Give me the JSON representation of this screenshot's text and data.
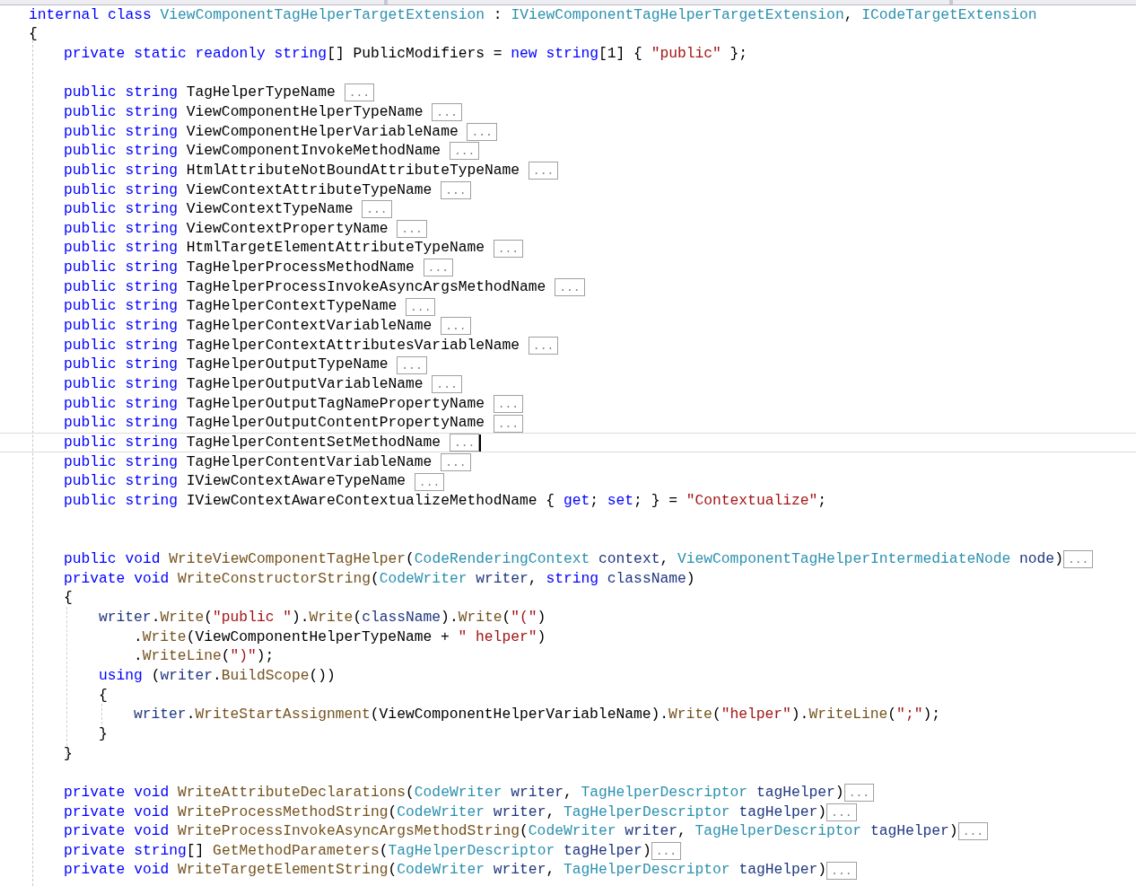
{
  "lines": [
    {
      "kind": "code",
      "current": false,
      "tokens": [
        {
          "kind": "keyword",
          "text": "internal class "
        },
        {
          "kind": "type",
          "text": "ViewComponentTagHelperTargetExtension"
        },
        {
          "kind": "plain",
          "text": " : "
        },
        {
          "kind": "type",
          "text": "IViewComponentTagHelperTargetExtension"
        },
        {
          "kind": "plain",
          "text": ", "
        },
        {
          "kind": "type",
          "text": "ICodeTargetExtension"
        }
      ]
    },
    {
      "kind": "code",
      "current": false,
      "tokens": [
        {
          "kind": "plain",
          "text": "{"
        }
      ],
      "children": [
        {
          "kind": "code",
          "current": false,
          "tokens": [
            {
              "kind": "keyword",
              "text": "private static readonly string"
            },
            {
              "kind": "plain",
              "text": "[] PublicModifiers = "
            },
            {
              "kind": "keyword",
              "text": "new string"
            },
            {
              "kind": "plain",
              "text": "[1] { "
            },
            {
              "kind": "string",
              "text": "\"public\""
            },
            {
              "kind": "plain",
              "text": " };"
            }
          ]
        },
        {
          "kind": "blank",
          "current": false
        },
        {
          "kind": "code",
          "current": false,
          "tokens": [
            {
              "kind": "keyword",
              "text": "public string"
            },
            {
              "kind": "plain",
              "text": " TagHelperTypeName "
            }
          ],
          "fold": "..."
        },
        {
          "kind": "code",
          "current": false,
          "tokens": [
            {
              "kind": "keyword",
              "text": "public string"
            },
            {
              "kind": "plain",
              "text": " ViewComponentHelperTypeName "
            }
          ],
          "fold": "..."
        },
        {
          "kind": "code",
          "current": false,
          "tokens": [
            {
              "kind": "keyword",
              "text": "public string"
            },
            {
              "kind": "plain",
              "text": " ViewComponentHelperVariableName "
            }
          ],
          "fold": "..."
        },
        {
          "kind": "code",
          "current": false,
          "tokens": [
            {
              "kind": "keyword",
              "text": "public string"
            },
            {
              "kind": "plain",
              "text": " ViewComponentInvokeMethodName "
            }
          ],
          "fold": "..."
        },
        {
          "kind": "code",
          "current": false,
          "tokens": [
            {
              "kind": "keyword",
              "text": "public string"
            },
            {
              "kind": "plain",
              "text": " HtmlAttributeNotBoundAttributeTypeName "
            }
          ],
          "fold": "..."
        },
        {
          "kind": "code",
          "current": false,
          "tokens": [
            {
              "kind": "keyword",
              "text": "public string"
            },
            {
              "kind": "plain",
              "text": " ViewContextAttributeTypeName "
            }
          ],
          "fold": "..."
        },
        {
          "kind": "code",
          "current": false,
          "tokens": [
            {
              "kind": "keyword",
              "text": "public string"
            },
            {
              "kind": "plain",
              "text": " ViewContextTypeName "
            }
          ],
          "fold": "..."
        },
        {
          "kind": "code",
          "current": false,
          "tokens": [
            {
              "kind": "keyword",
              "text": "public string"
            },
            {
              "kind": "plain",
              "text": " ViewContextPropertyName "
            }
          ],
          "fold": "..."
        },
        {
          "kind": "code",
          "current": false,
          "tokens": [
            {
              "kind": "keyword",
              "text": "public string"
            },
            {
              "kind": "plain",
              "text": " HtmlTargetElementAttributeTypeName "
            }
          ],
          "fold": "..."
        },
        {
          "kind": "code",
          "current": false,
          "tokens": [
            {
              "kind": "keyword",
              "text": "public string"
            },
            {
              "kind": "plain",
              "text": " TagHelperProcessMethodName "
            }
          ],
          "fold": "..."
        },
        {
          "kind": "code",
          "current": false,
          "tokens": [
            {
              "kind": "keyword",
              "text": "public string"
            },
            {
              "kind": "plain",
              "text": " TagHelperProcessInvokeAsyncArgsMethodName "
            }
          ],
          "fold": "..."
        },
        {
          "kind": "code",
          "current": false,
          "tokens": [
            {
              "kind": "keyword",
              "text": "public string"
            },
            {
              "kind": "plain",
              "text": " TagHelperContextTypeName "
            }
          ],
          "fold": "..."
        },
        {
          "kind": "code",
          "current": false,
          "tokens": [
            {
              "kind": "keyword",
              "text": "public string"
            },
            {
              "kind": "plain",
              "text": " TagHelperContextVariableName "
            }
          ],
          "fold": "..."
        },
        {
          "kind": "code",
          "current": false,
          "tokens": [
            {
              "kind": "keyword",
              "text": "public string"
            },
            {
              "kind": "plain",
              "text": " TagHelperContextAttributesVariableName "
            }
          ],
          "fold": "..."
        },
        {
          "kind": "code",
          "current": false,
          "tokens": [
            {
              "kind": "keyword",
              "text": "public string"
            },
            {
              "kind": "plain",
              "text": " TagHelperOutputTypeName "
            }
          ],
          "fold": "..."
        },
        {
          "kind": "code",
          "current": false,
          "tokens": [
            {
              "kind": "keyword",
              "text": "public string"
            },
            {
              "kind": "plain",
              "text": " TagHelperOutputVariableName "
            }
          ],
          "fold": "..."
        },
        {
          "kind": "code",
          "current": false,
          "tokens": [
            {
              "kind": "keyword",
              "text": "public string"
            },
            {
              "kind": "plain",
              "text": " TagHelperOutputTagNamePropertyName "
            }
          ],
          "fold": "..."
        },
        {
          "kind": "code",
          "current": false,
          "tokens": [
            {
              "kind": "keyword",
              "text": "public string"
            },
            {
              "kind": "plain",
              "text": " TagHelperOutputContentPropertyName "
            }
          ],
          "fold": "..."
        },
        {
          "kind": "code",
          "current": true,
          "tokens": [
            {
              "kind": "keyword",
              "text": "public string"
            },
            {
              "kind": "plain",
              "text": " TagHelperContentSetMethodName "
            }
          ],
          "fold": "..."
        },
        {
          "kind": "code",
          "current": false,
          "tokens": [
            {
              "kind": "keyword",
              "text": "public string"
            },
            {
              "kind": "plain",
              "text": " TagHelperContentVariableName "
            }
          ],
          "fold": "..."
        },
        {
          "kind": "code",
          "current": false,
          "tokens": [
            {
              "kind": "keyword",
              "text": "public string"
            },
            {
              "kind": "plain",
              "text": " IViewContextAwareTypeName "
            }
          ],
          "fold": "..."
        },
        {
          "kind": "code",
          "current": false,
          "tokens": [
            {
              "kind": "keyword",
              "text": "public string"
            },
            {
              "kind": "plain",
              "text": " IViewContextAwareContextualizeMethodName { "
            },
            {
              "kind": "keyword",
              "text": "get"
            },
            {
              "kind": "plain",
              "text": "; "
            },
            {
              "kind": "keyword",
              "text": "set"
            },
            {
              "kind": "plain",
              "text": "; } = "
            },
            {
              "kind": "string",
              "text": "\"Contextualize\""
            },
            {
              "kind": "plain",
              "text": ";"
            }
          ]
        },
        {
          "kind": "blank",
          "current": false
        },
        {
          "kind": "blank",
          "current": false
        },
        {
          "kind": "code",
          "current": false,
          "tokens": [
            {
              "kind": "keyword",
              "text": "public void "
            },
            {
              "kind": "method",
              "text": "WriteViewComponentTagHelper"
            },
            {
              "kind": "plain",
              "text": "("
            },
            {
              "kind": "type",
              "text": "CodeRenderingContext "
            },
            {
              "kind": "param",
              "text": "context"
            },
            {
              "kind": "plain",
              "text": ", "
            },
            {
              "kind": "type",
              "text": "ViewComponentTagHelperIntermediateNode "
            },
            {
              "kind": "param",
              "text": "node"
            },
            {
              "kind": "plain",
              "text": ")"
            }
          ],
          "fold": "..."
        },
        {
          "kind": "code",
          "current": false,
          "tokens": [
            {
              "kind": "keyword",
              "text": "private void "
            },
            {
              "kind": "method",
              "text": "WriteConstructorString"
            },
            {
              "kind": "plain",
              "text": "("
            },
            {
              "kind": "type",
              "text": "CodeWriter "
            },
            {
              "kind": "param",
              "text": "writer"
            },
            {
              "kind": "plain",
              "text": ", "
            },
            {
              "kind": "keyword",
              "text": "string "
            },
            {
              "kind": "param",
              "text": "className"
            },
            {
              "kind": "plain",
              "text": ")"
            }
          ]
        },
        {
          "kind": "code",
          "current": false,
          "tokens": [
            {
              "kind": "plain",
              "text": "{"
            }
          ],
          "children": [
            {
              "kind": "code",
              "current": false,
              "tokens": [
                {
                  "kind": "param",
                  "text": "writer"
                },
                {
                  "kind": "plain",
                  "text": "."
                },
                {
                  "kind": "method",
                  "text": "Write"
                },
                {
                  "kind": "plain",
                  "text": "("
                },
                {
                  "kind": "string",
                  "text": "\"public \""
                },
                {
                  "kind": "plain",
                  "text": ")."
                },
                {
                  "kind": "method",
                  "text": "Write"
                },
                {
                  "kind": "plain",
                  "text": "("
                },
                {
                  "kind": "param",
                  "text": "className"
                },
                {
                  "kind": "plain",
                  "text": ")."
                },
                {
                  "kind": "method",
                  "text": "Write"
                },
                {
                  "kind": "plain",
                  "text": "("
                },
                {
                  "kind": "string",
                  "text": "\"(\""
                },
                {
                  "kind": "plain",
                  "text": ")"
                }
              ],
              "children": [
                {
                  "kind": "code",
                  "current": false,
                  "tokens": [
                    {
                      "kind": "plain",
                      "text": "."
                    },
                    {
                      "kind": "method",
                      "text": "Write"
                    },
                    {
                      "kind": "plain",
                      "text": "(ViewComponentHelperTypeName + "
                    },
                    {
                      "kind": "string",
                      "text": "\" helper\""
                    },
                    {
                      "kind": "plain",
                      "text": ")"
                    }
                  ]
                },
                {
                  "kind": "code",
                  "current": false,
                  "tokens": [
                    {
                      "kind": "plain",
                      "text": "."
                    },
                    {
                      "kind": "method",
                      "text": "WriteLine"
                    },
                    {
                      "kind": "plain",
                      "text": "("
                    },
                    {
                      "kind": "string",
                      "text": "\")\""
                    },
                    {
                      "kind": "plain",
                      "text": ");"
                    }
                  ]
                }
              ]
            },
            {
              "kind": "code",
              "current": false,
              "tokens": [
                {
                  "kind": "keyword",
                  "text": "using"
                },
                {
                  "kind": "plain",
                  "text": " ("
                },
                {
                  "kind": "param",
                  "text": "writer"
                },
                {
                  "kind": "plain",
                  "text": "."
                },
                {
                  "kind": "method",
                  "text": "BuildScope"
                },
                {
                  "kind": "plain",
                  "text": "())"
                }
              ]
            },
            {
              "kind": "code",
              "current": false,
              "tokens": [
                {
                  "kind": "plain",
                  "text": "{"
                }
              ],
              "children": [
                {
                  "kind": "code",
                  "current": false,
                  "tokens": [
                    {
                      "kind": "param",
                      "text": "writer"
                    },
                    {
                      "kind": "plain",
                      "text": "."
                    },
                    {
                      "kind": "method",
                      "text": "WriteStartAssignment"
                    },
                    {
                      "kind": "plain",
                      "text": "(ViewComponentHelperVariableName)."
                    },
                    {
                      "kind": "method",
                      "text": "Write"
                    },
                    {
                      "kind": "plain",
                      "text": "("
                    },
                    {
                      "kind": "string",
                      "text": "\"helper\""
                    },
                    {
                      "kind": "plain",
                      "text": ")."
                    },
                    {
                      "kind": "method",
                      "text": "WriteLine"
                    },
                    {
                      "kind": "plain",
                      "text": "("
                    },
                    {
                      "kind": "string",
                      "text": "\";\""
                    },
                    {
                      "kind": "plain",
                      "text": ");"
                    }
                  ]
                }
              ]
            },
            {
              "kind": "code",
              "current": false,
              "tokens": [
                {
                  "kind": "plain",
                  "text": "}"
                }
              ]
            }
          ]
        },
        {
          "kind": "code",
          "current": false,
          "tokens": [
            {
              "kind": "plain",
              "text": "}"
            }
          ]
        },
        {
          "kind": "blank",
          "current": false
        },
        {
          "kind": "code",
          "current": false,
          "tokens": [
            {
              "kind": "keyword",
              "text": "private void "
            },
            {
              "kind": "method",
              "text": "WriteAttributeDeclarations"
            },
            {
              "kind": "plain",
              "text": "("
            },
            {
              "kind": "type",
              "text": "CodeWriter "
            },
            {
              "kind": "param",
              "text": "writer"
            },
            {
              "kind": "plain",
              "text": ", "
            },
            {
              "kind": "type",
              "text": "TagHelperDescriptor "
            },
            {
              "kind": "param",
              "text": "tagHelper"
            },
            {
              "kind": "plain",
              "text": ")"
            }
          ],
          "fold": "..."
        },
        {
          "kind": "code",
          "current": false,
          "tokens": [
            {
              "kind": "keyword",
              "text": "private void "
            },
            {
              "kind": "method",
              "text": "WriteProcessMethodString"
            },
            {
              "kind": "plain",
              "text": "("
            },
            {
              "kind": "type",
              "text": "CodeWriter "
            },
            {
              "kind": "param",
              "text": "writer"
            },
            {
              "kind": "plain",
              "text": ", "
            },
            {
              "kind": "type",
              "text": "TagHelperDescriptor "
            },
            {
              "kind": "param",
              "text": "tagHelper"
            },
            {
              "kind": "plain",
              "text": ")"
            }
          ],
          "fold": "..."
        },
        {
          "kind": "code",
          "current": false,
          "tokens": [
            {
              "kind": "keyword",
              "text": "private void "
            },
            {
              "kind": "method",
              "text": "WriteProcessInvokeAsyncArgsMethodString"
            },
            {
              "kind": "plain",
              "text": "("
            },
            {
              "kind": "type",
              "text": "CodeWriter "
            },
            {
              "kind": "param",
              "text": "writer"
            },
            {
              "kind": "plain",
              "text": ", "
            },
            {
              "kind": "type",
              "text": "TagHelperDescriptor "
            },
            {
              "kind": "param",
              "text": "tagHelper"
            },
            {
              "kind": "plain",
              "text": ")"
            }
          ],
          "fold": "..."
        },
        {
          "kind": "code",
          "current": false,
          "tokens": [
            {
              "kind": "keyword",
              "text": "private string"
            },
            {
              "kind": "plain",
              "text": "[] "
            },
            {
              "kind": "method",
              "text": "GetMethodParameters"
            },
            {
              "kind": "plain",
              "text": "("
            },
            {
              "kind": "type",
              "text": "TagHelperDescriptor "
            },
            {
              "kind": "param",
              "text": "tagHelper"
            },
            {
              "kind": "plain",
              "text": ")"
            }
          ],
          "fold": "..."
        },
        {
          "kind": "code",
          "current": false,
          "tokens": [
            {
              "kind": "keyword",
              "text": "private void "
            },
            {
              "kind": "method",
              "text": "WriteTargetElementString"
            },
            {
              "kind": "plain",
              "text": "("
            },
            {
              "kind": "type",
              "text": "CodeWriter "
            },
            {
              "kind": "param",
              "text": "writer"
            },
            {
              "kind": "plain",
              "text": ", "
            },
            {
              "kind": "type",
              "text": "TagHelperDescriptor "
            },
            {
              "kind": "param",
              "text": "tagHelper"
            },
            {
              "kind": "plain",
              "text": ")"
            }
          ],
          "fold": "..."
        }
      ]
    }
  ]
}
